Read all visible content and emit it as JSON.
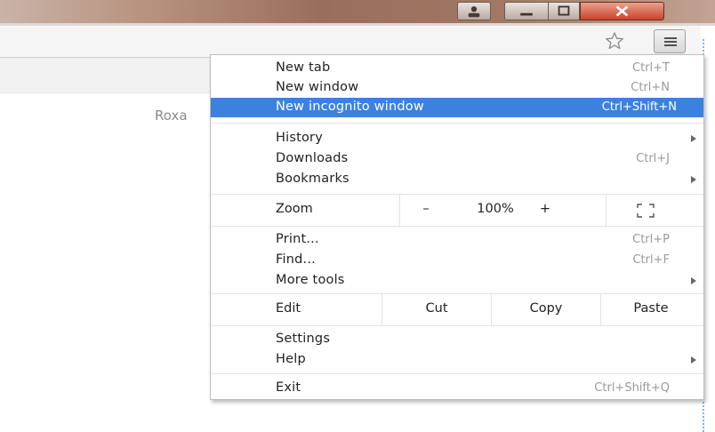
{
  "window": {
    "controls": [
      {
        "name": "user-icon"
      },
      {
        "name": "minimize-icon"
      },
      {
        "name": "maximize-icon"
      },
      {
        "name": "close-icon"
      }
    ]
  },
  "toolbar": {
    "bookmark_icon": "star-icon",
    "menu_icon": "hamburger-menu-icon"
  },
  "page": {
    "partial_text": "Roxa"
  },
  "menu": {
    "new_tab": {
      "label": "New tab",
      "shortcut": "Ctrl+T"
    },
    "new_window": {
      "label": "New window",
      "shortcut": "Ctrl+N"
    },
    "new_incognito": {
      "label": "New incognito window",
      "shortcut": "Ctrl+Shift+N"
    },
    "history": {
      "label": "History"
    },
    "downloads": {
      "label": "Downloads",
      "shortcut": "Ctrl+J"
    },
    "bookmarks": {
      "label": "Bookmarks"
    },
    "zoom": {
      "label": "Zoom",
      "minus": "–",
      "level": "100%",
      "plus": "+"
    },
    "print": {
      "label": "Print...",
      "shortcut": "Ctrl+P"
    },
    "find": {
      "label": "Find...",
      "shortcut": "Ctrl+F"
    },
    "more_tools": {
      "label": "More tools"
    },
    "edit": {
      "label": "Edit",
      "cut": "Cut",
      "copy": "Copy",
      "paste": "Paste"
    },
    "settings": {
      "label": "Settings"
    },
    "help": {
      "label": "Help"
    },
    "exit": {
      "label": "Exit",
      "shortcut": "Ctrl+Shift+Q"
    },
    "highlight_color": "#3b82e0"
  }
}
